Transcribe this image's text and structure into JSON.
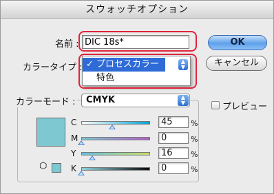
{
  "window": {
    "title": "スウォッチオプション"
  },
  "name_field": {
    "label": "名前 :",
    "value": "DIC 18s*"
  },
  "color_type": {
    "label": "カラータイプ :",
    "options": [
      {
        "label": "プロセスカラー",
        "selected": true,
        "check": "✓"
      },
      {
        "label": "特色",
        "selected": false
      }
    ]
  },
  "buttons": {
    "ok": "OK",
    "cancel": "キャンセル"
  },
  "color_mode": {
    "label": "カラーモード :",
    "value": "CMYK"
  },
  "preview": {
    "label": "プレビュー",
    "checked": false
  },
  "swatch_color": "#7ec8d2",
  "channels": [
    {
      "letter": "C",
      "value": "45",
      "unit": "%",
      "level": 0.45,
      "track_from": "#ffffff",
      "track_to": "#00a5d6"
    },
    {
      "letter": "M",
      "value": "0",
      "unit": "%",
      "level": 0.0,
      "track_from": "#7ec8d2",
      "track_to": "#b45ec8"
    },
    {
      "letter": "Y",
      "value": "16",
      "unit": "%",
      "level": 0.16,
      "track_from": "#67c0e2",
      "track_to": "#c8e066"
    },
    {
      "letter": "K",
      "value": "0",
      "unit": "%",
      "level": 0.0,
      "track_from": "#8fd2df",
      "track_to": "#0a0a0a"
    }
  ],
  "highlight_color": "#e0233a"
}
